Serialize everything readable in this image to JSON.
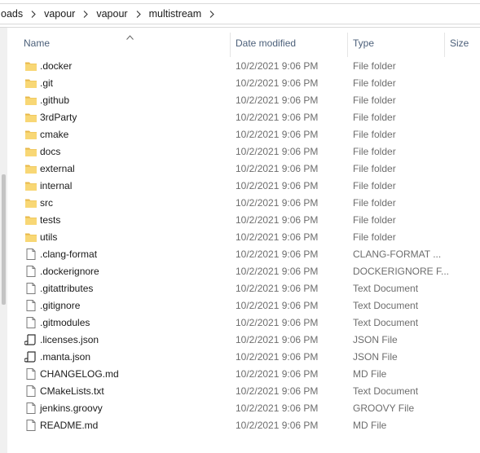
{
  "breadcrumb": [
    "oads",
    "vapour",
    "vapour",
    "multistream"
  ],
  "columns": {
    "name": "Name",
    "date": "Date modified",
    "type": "Type",
    "size": "Size"
  },
  "files": [
    {
      "name": ".docker",
      "date": "10/2/2021 9:06 PM",
      "type": "File folder",
      "icon": "folder-icon"
    },
    {
      "name": ".git",
      "date": "10/2/2021 9:06 PM",
      "type": "File folder",
      "icon": "folder-icon"
    },
    {
      "name": ".github",
      "date": "10/2/2021 9:06 PM",
      "type": "File folder",
      "icon": "folder-icon"
    },
    {
      "name": "3rdParty",
      "date": "10/2/2021 9:06 PM",
      "type": "File folder",
      "icon": "folder-icon"
    },
    {
      "name": "cmake",
      "date": "10/2/2021 9:06 PM",
      "type": "File folder",
      "icon": "folder-icon"
    },
    {
      "name": "docs",
      "date": "10/2/2021 9:06 PM",
      "type": "File folder",
      "icon": "folder-icon"
    },
    {
      "name": "external",
      "date": "10/2/2021 9:06 PM",
      "type": "File folder",
      "icon": "folder-icon"
    },
    {
      "name": "internal",
      "date": "10/2/2021 9:06 PM",
      "type": "File folder",
      "icon": "folder-icon"
    },
    {
      "name": "src",
      "date": "10/2/2021 9:06 PM",
      "type": "File folder",
      "icon": "folder-icon"
    },
    {
      "name": "tests",
      "date": "10/2/2021 9:06 PM",
      "type": "File folder",
      "icon": "folder-icon"
    },
    {
      "name": "utils",
      "date": "10/2/2021 9:06 PM",
      "type": "File folder",
      "icon": "folder-icon"
    },
    {
      "name": ".clang-format",
      "date": "10/2/2021 9:06 PM",
      "type": "CLANG-FORMAT ...",
      "icon": "file-icon"
    },
    {
      "name": ".dockerignore",
      "date": "10/2/2021 9:06 PM",
      "type": "DOCKERIGNORE F...",
      "icon": "file-icon"
    },
    {
      "name": ".gitattributes",
      "date": "10/2/2021 9:06 PM",
      "type": "Text Document",
      "icon": "file-icon"
    },
    {
      "name": ".gitignore",
      "date": "10/2/2021 9:06 PM",
      "type": "Text Document",
      "icon": "file-icon"
    },
    {
      "name": ".gitmodules",
      "date": "10/2/2021 9:06 PM",
      "type": "Text Document",
      "icon": "file-icon"
    },
    {
      "name": ".licenses.json",
      "date": "10/2/2021 9:06 PM",
      "type": "JSON File",
      "icon": "json-icon"
    },
    {
      "name": ".manta.json",
      "date": "10/2/2021 9:06 PM",
      "type": "JSON File",
      "icon": "json-icon"
    },
    {
      "name": "CHANGELOG.md",
      "date": "10/2/2021 9:06 PM",
      "type": "MD File",
      "icon": "file-icon"
    },
    {
      "name": "CMakeLists.txt",
      "date": "10/2/2021 9:06 PM",
      "type": "Text Document",
      "icon": "file-icon"
    },
    {
      "name": "jenkins.groovy",
      "date": "10/2/2021 9:06 PM",
      "type": "GROOVY File",
      "icon": "file-icon"
    },
    {
      "name": "README.md",
      "date": "10/2/2021 9:06 PM",
      "type": "MD File",
      "icon": "file-icon"
    }
  ],
  "colors": {
    "folder": "#f8d775",
    "folder_dark": "#e8b84a",
    "header_text": "#4c607a",
    "muted_text": "#6d6d6d"
  }
}
